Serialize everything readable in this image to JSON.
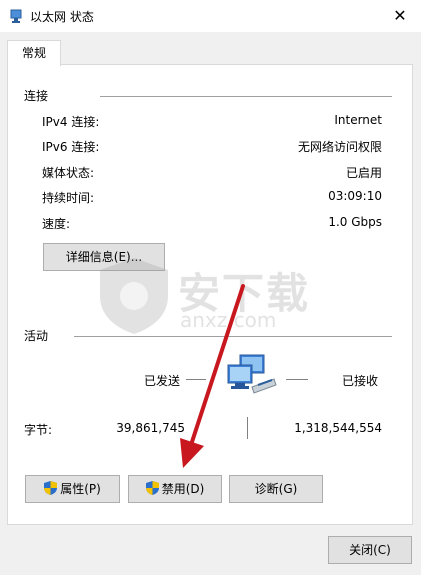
{
  "window": {
    "title": "以太网 状态",
    "close_glyph": "✕"
  },
  "tabs": [
    {
      "label": "常规"
    }
  ],
  "connection": {
    "section_title": "连接",
    "rows": [
      {
        "label": "IPv4 连接:",
        "value": "Internet"
      },
      {
        "label": "IPv6 连接:",
        "value": "无网络访问权限"
      },
      {
        "label": "媒体状态:",
        "value": "已启用"
      },
      {
        "label": "持续时间:",
        "value": "03:09:10"
      },
      {
        "label": "速度:",
        "value": "1.0 Gbps"
      }
    ],
    "details_button": "详细信息(E)..."
  },
  "activity": {
    "section_title": "活动",
    "sent_label": "已发送",
    "received_label": "已接收",
    "bytes_label": "字节:",
    "bytes_sent": "39,861,745",
    "bytes_received": "1,318,544,554"
  },
  "buttons": {
    "properties": "属性(P)",
    "disable": "禁用(D)",
    "diagnose": "诊断(G)",
    "close": "关闭(C)"
  },
  "watermark": {
    "text": "安下载",
    "sub": "anxz.com"
  },
  "colors": {
    "arrow": "#c8171e",
    "shield_blue": "#2a6fc9",
    "shield_yellow": "#f2c200"
  }
}
